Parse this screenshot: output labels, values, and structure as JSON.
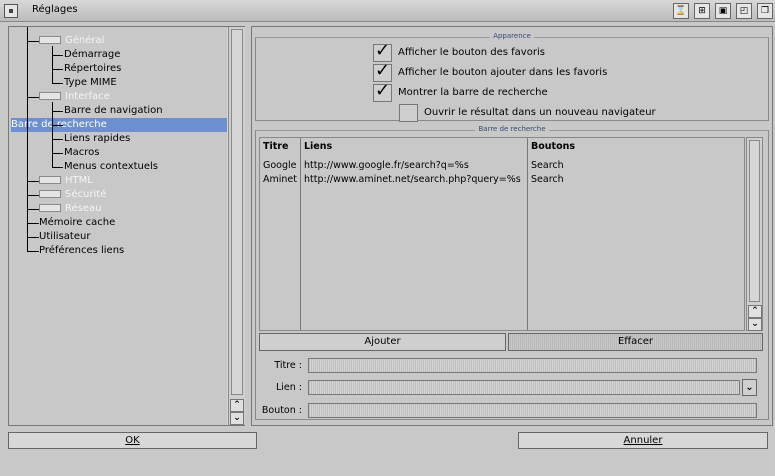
{
  "window": {
    "title": "Réglages"
  },
  "tree": {
    "items": [
      {
        "label": "Général",
        "level": 1,
        "folder": true
      },
      {
        "label": "Démarrage",
        "level": 2
      },
      {
        "label": "Répertoires",
        "level": 2
      },
      {
        "label": "Type MIME",
        "level": 2
      },
      {
        "label": "Interface",
        "level": 1,
        "folder": true
      },
      {
        "label": "Barre de navigation",
        "level": 2
      },
      {
        "label": "Barre de recherche",
        "level": 2,
        "selected": true
      },
      {
        "label": "Liens rapides",
        "level": 2
      },
      {
        "label": "Macros",
        "level": 2
      },
      {
        "label": "Menus contextuels",
        "level": 2
      },
      {
        "label": "HTML",
        "level": 1,
        "folder": true
      },
      {
        "label": "Sécurité",
        "level": 1,
        "folder": true
      },
      {
        "label": "Réseau",
        "level": 1,
        "folder": true
      },
      {
        "label": "Mémoire cache",
        "level": 1
      },
      {
        "label": "Utilisateur",
        "level": 1
      },
      {
        "label": "Préférences liens",
        "level": 1
      }
    ]
  },
  "apparence": {
    "title": "Apparence",
    "options": [
      {
        "label": "Afficher le bouton des favoris",
        "checked": true
      },
      {
        "label": "Afficher le bouton ajouter dans les favoris",
        "checked": true
      },
      {
        "label": "Montrer la barre de recherche",
        "checked": true
      },
      {
        "label": "Ouvrir le résultat dans un nouveau navigateur",
        "checked": false
      }
    ]
  },
  "search_bar": {
    "title": "Barre de recherche",
    "columns": [
      "Titre",
      "Liens",
      "Boutons"
    ],
    "rows": [
      [
        "Google",
        "http://www.google.fr/search?q=%s",
        "Search"
      ],
      [
        "Aminet",
        "http://www.aminet.net/search.php?query=%s",
        "Search"
      ]
    ],
    "add_label": "Ajouter",
    "delete_label": "Effacer",
    "title_label": "Titre :",
    "link_label": "Lien :",
    "button_label": "Bouton :"
  },
  "footer": {
    "ok_label": "OK",
    "cancel_label": "Annuler"
  }
}
